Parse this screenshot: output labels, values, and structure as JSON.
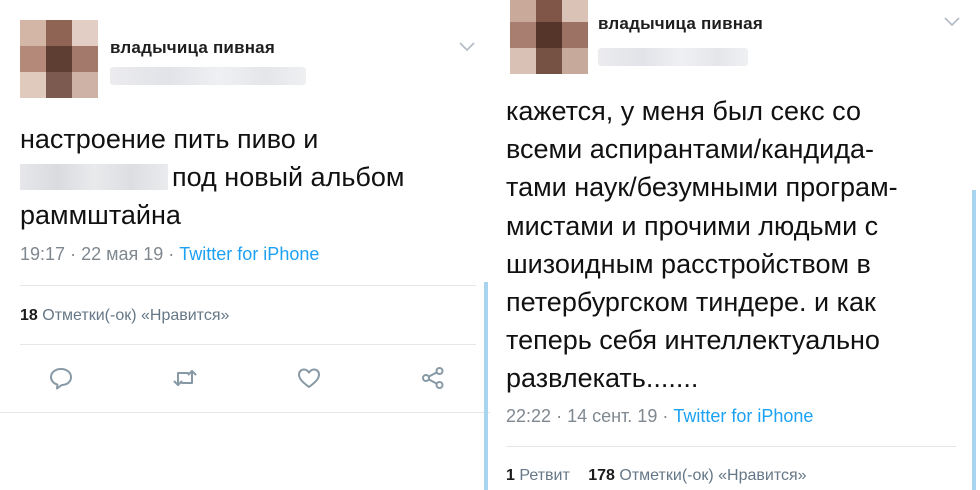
{
  "left_tweet": {
    "author_name": "владычица пивная",
    "text_line1": "настроение пить пиво и",
    "text_line2": "под новый альбом",
    "text_line3": "раммштайна",
    "time": "19:17",
    "date": "22 мая 19",
    "separator": "·",
    "source": "Twitter for iPhone",
    "likes_count": "18",
    "likes_label": "Отметки(-ок) «Нравится»",
    "icons": [
      "chevron-down-icon",
      "reply-icon",
      "retweet-icon",
      "like-icon",
      "share-icon"
    ]
  },
  "right_tweet": {
    "author_name": "владычица пивная",
    "text_lines": [
      "кажется, у меня был секс со",
      "всеми аспирантами/кандида-",
      "тами наук/безумными програм-",
      "мистами и прочими людьми с",
      "шизоидным расстройством в",
      "петербургском тиндере. и как",
      "теперь себя интеллектуально",
      "развлекать......."
    ],
    "time": "22:22",
    "date": "14 сент. 19",
    "separator": "·",
    "source": "Twitter for iPhone",
    "retweets_count": "1",
    "retweets_label": "Ретвит",
    "likes_count": "178",
    "likes_label": "Отметки(-ок) «Нравится»",
    "icons": [
      "chevron-down-icon"
    ]
  },
  "colors": {
    "accent": "#1da1f2",
    "muted": "#7f8890",
    "icon": "#8899a6",
    "divider": "#e4e7ea",
    "side_bar": "#a8d4ef"
  }
}
